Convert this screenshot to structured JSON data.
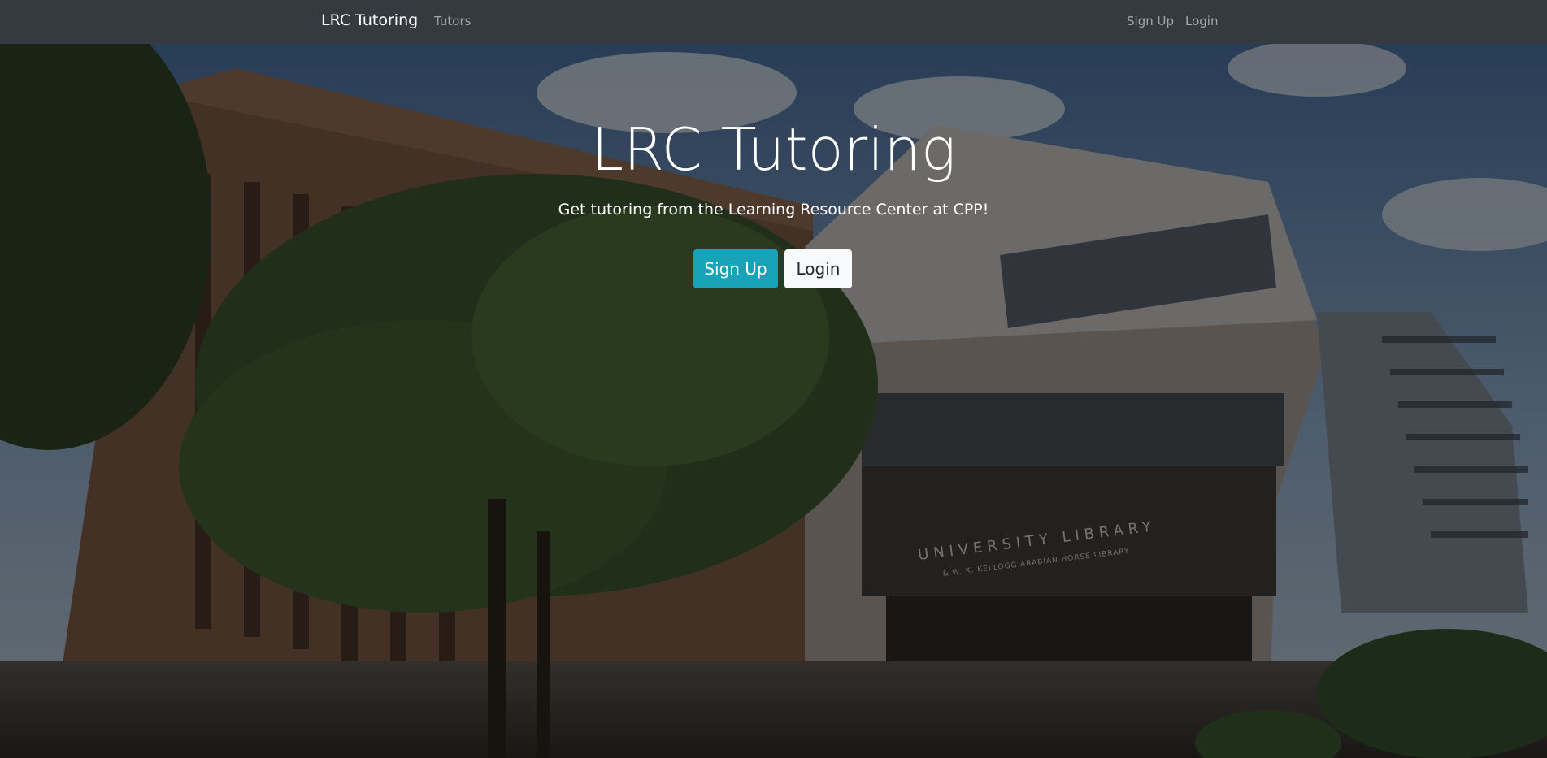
{
  "navbar": {
    "brand": "LRC Tutoring",
    "links": [
      "Tutors"
    ],
    "right_links": [
      "Sign Up",
      "Login"
    ]
  },
  "hero": {
    "title": "LRC Tutoring",
    "subtitle": "Get tutoring from the Learning Resource Center at CPP!",
    "signup_label": "Sign Up",
    "login_label": "Login",
    "building_sign": "UNIVERSITY LIBRARY",
    "building_sign_sub": "& W. K. KELLOGG ARABIAN HORSE LIBRARY"
  },
  "colors": {
    "navbar_bg": "#343a40",
    "accent": "#17a2b8",
    "light_button": "#f8f9fa"
  }
}
